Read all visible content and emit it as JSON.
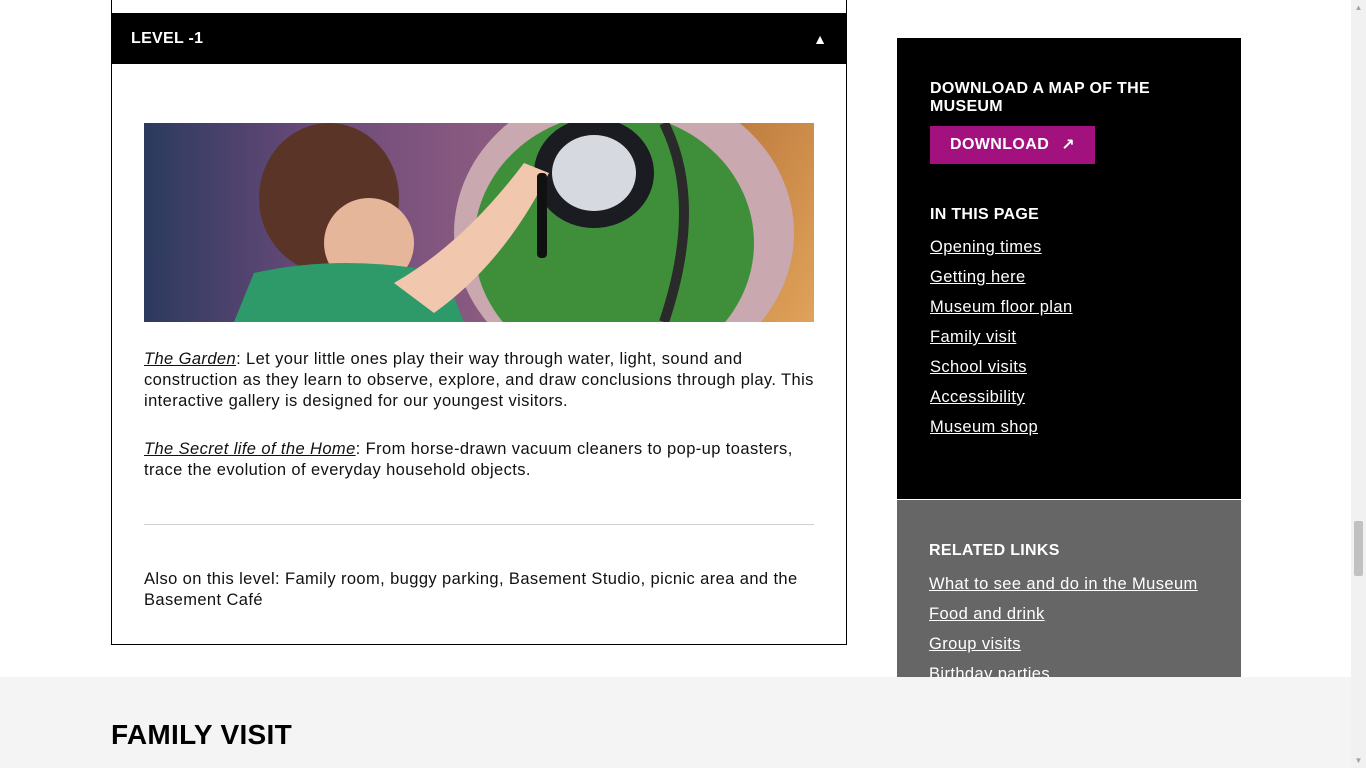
{
  "accordion": {
    "title": "LEVEL -1",
    "toggle_symbol": "▲",
    "garden_link": "The Garden",
    "garden_text": ": Let your little ones play their way through water, light, sound and construction as they learn to observe, explore, and draw conclusions through play. This interactive gallery is designed for our youngest visitors.",
    "secret_link": "The Secret life of the Home",
    "secret_text": ": From horse-drawn vacuum cleaners to pop-up toasters, trace the evolution of everyday household objects.",
    "also_text": "Also on this level: Family room, buggy parking, Basement Studio, picnic area and the Basement Café"
  },
  "sidebar": {
    "map_heading": "DOWNLOAD A MAP OF THE MUSEUM",
    "download_label": "DOWNLOAD",
    "download_icon": "arrow-up-right-icon",
    "download_color": "#a3117e",
    "in_page_heading": "IN THIS PAGE",
    "in_page_links": [
      "Opening times",
      "Getting here",
      "Museum floor plan",
      "Family visit",
      "School visits",
      "Accessibility",
      "Museum shop"
    ],
    "related_heading": "RELATED LINKS",
    "related_links": [
      "What to see and do in the Museum",
      "Food and drink",
      "Group visits",
      "Birthday parties"
    ]
  },
  "bottom": {
    "title": "FAMILY VISIT"
  },
  "colors": {
    "accent": "#a3117e",
    "dark_panel": "#000000",
    "grey_panel": "#666666"
  }
}
